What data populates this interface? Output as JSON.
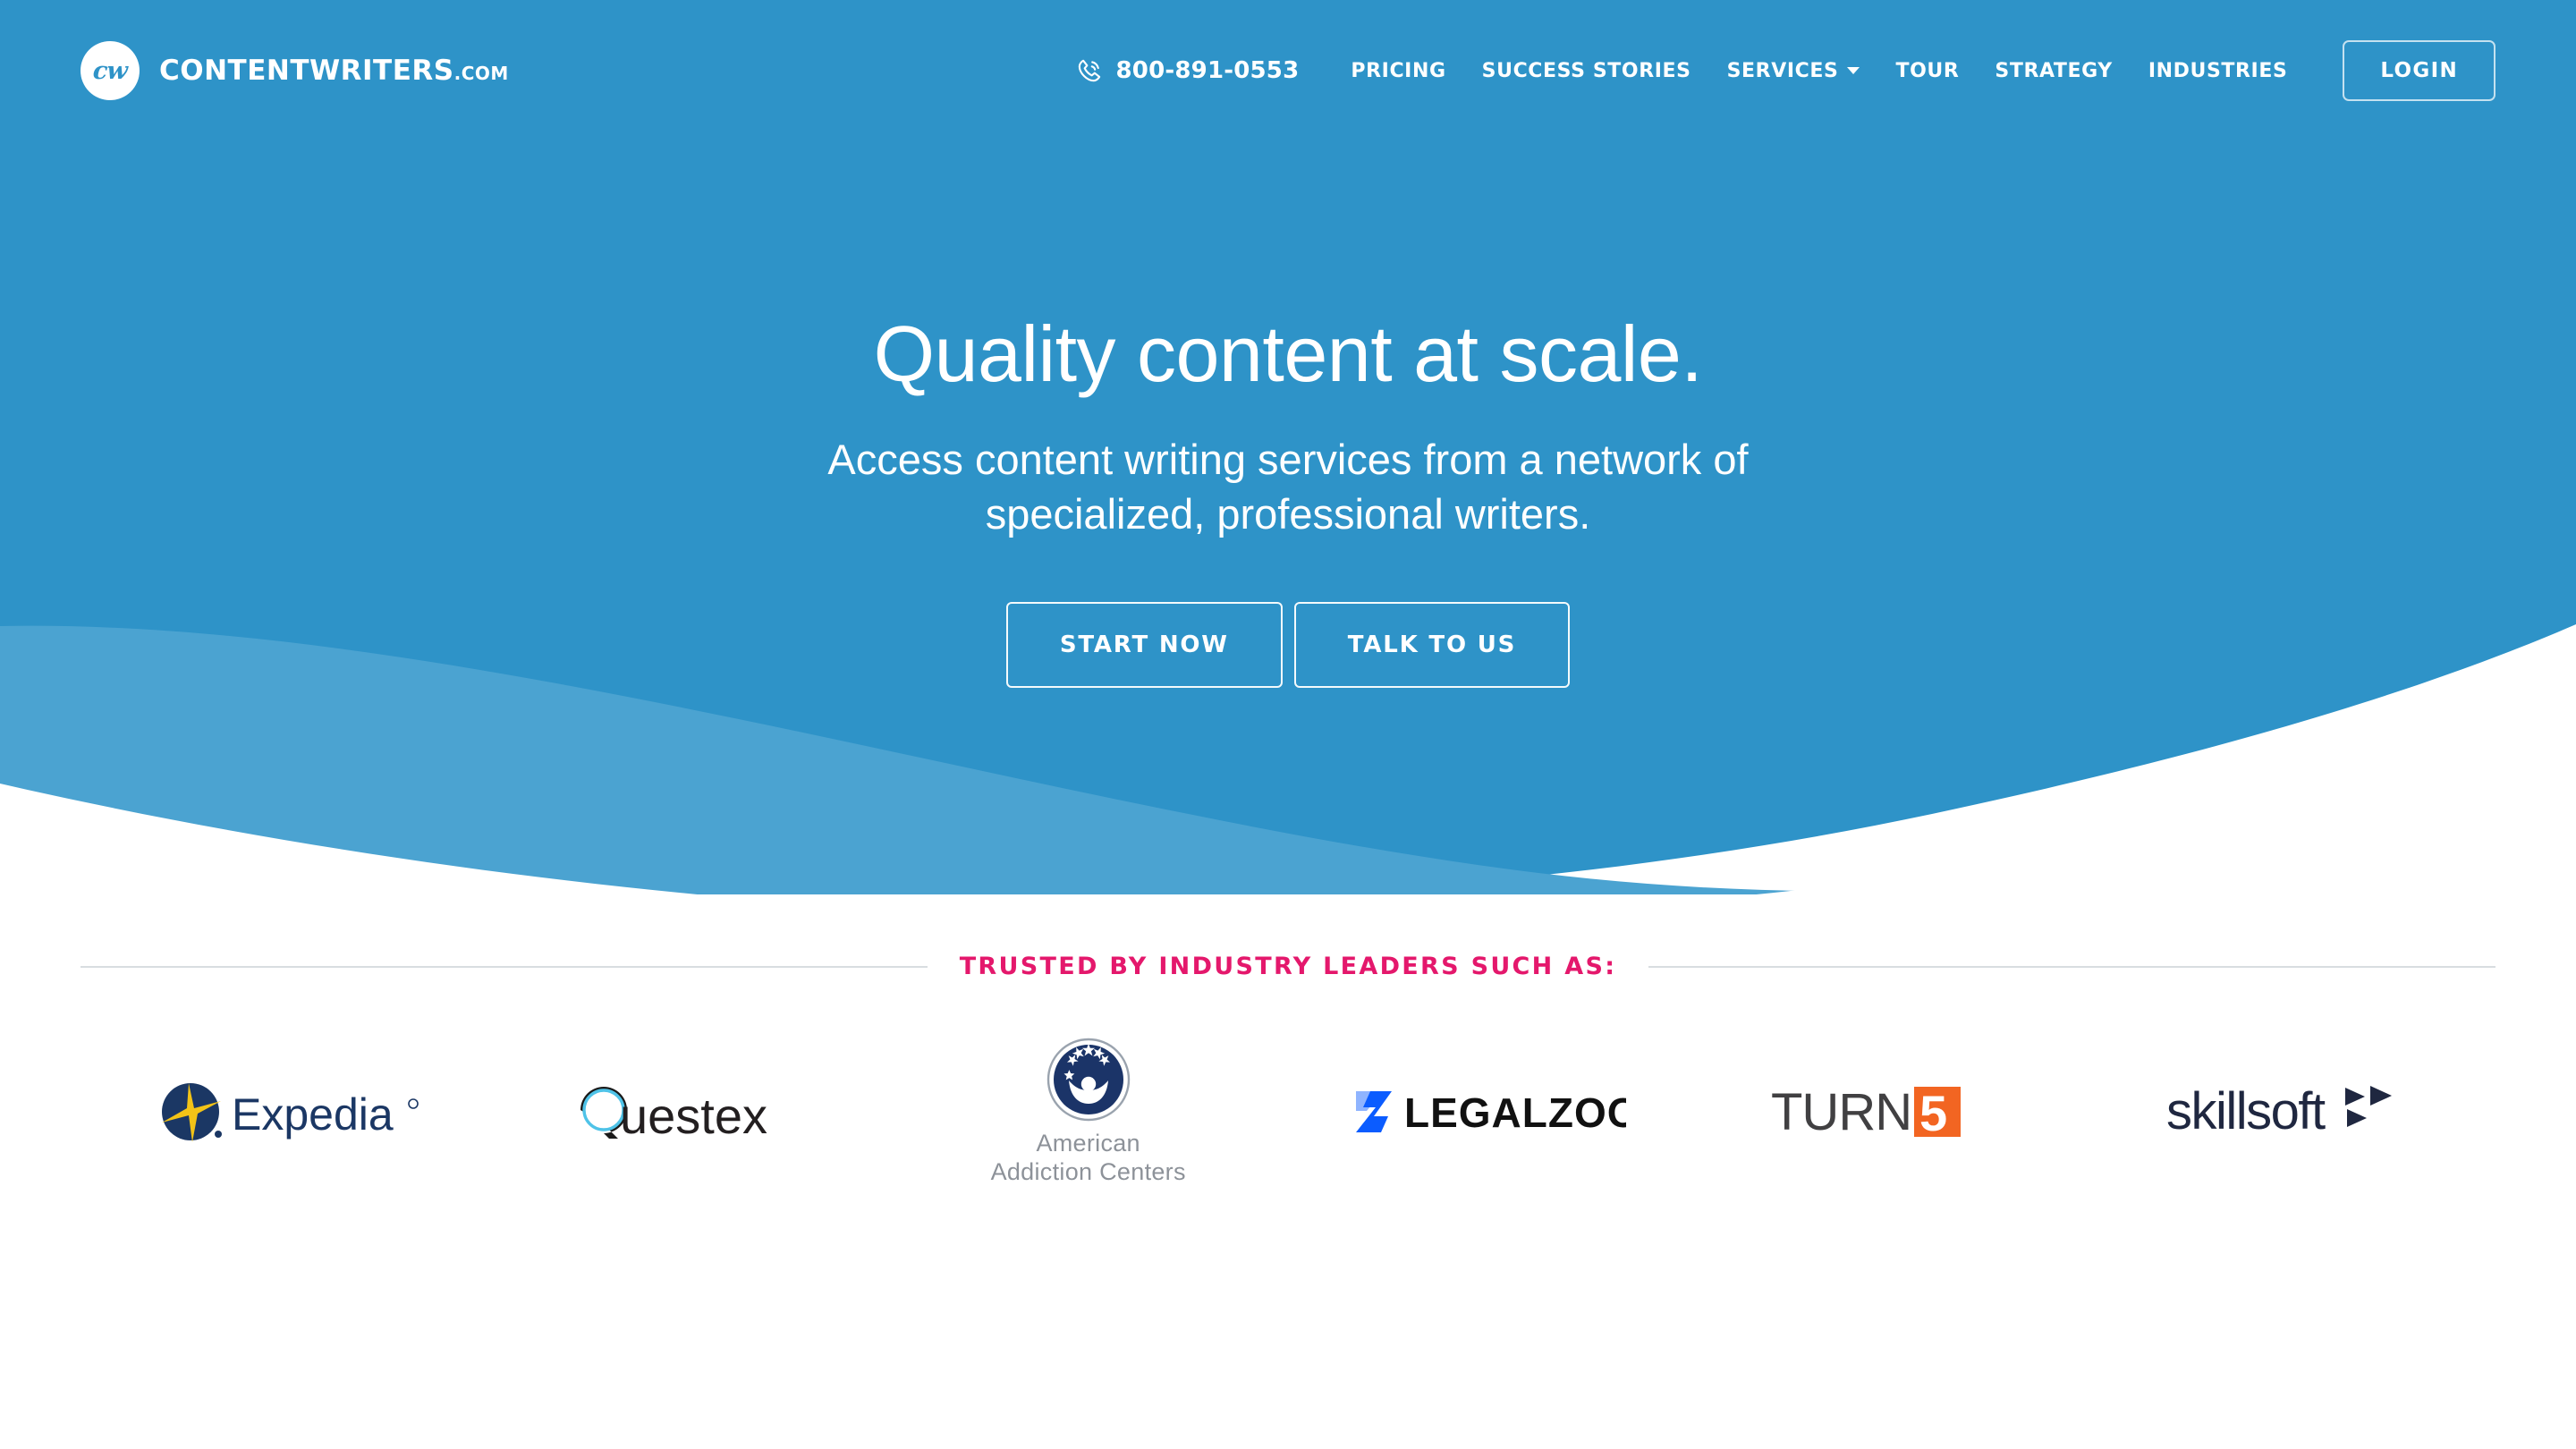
{
  "theme": {
    "hero_blue": "#2e93c8",
    "wave_light_blue": "#4ba3d1",
    "accent_pink": "#e4186c",
    "white": "#ffffff"
  },
  "header": {
    "brand": {
      "badge_text": "cw",
      "name": "CONTENTWRITERS",
      "tld": ".COM",
      "badge_icon": "cw-monogram-icon"
    },
    "phone": {
      "icon": "phone-icon",
      "number": "800-891-0553"
    },
    "nav_items": [
      {
        "label": "PRICING",
        "has_dropdown": false
      },
      {
        "label": "SUCCESS STORIES",
        "has_dropdown": false
      },
      {
        "label": "SERVICES",
        "has_dropdown": true
      },
      {
        "label": "TOUR",
        "has_dropdown": false
      },
      {
        "label": "STRATEGY",
        "has_dropdown": false
      },
      {
        "label": "INDUSTRIES",
        "has_dropdown": false
      }
    ],
    "login_label": "LOGIN"
  },
  "hero": {
    "title": "Quality content at scale.",
    "subtitle_line1": "Access content writing services from a network of",
    "subtitle_line2": "specialized, professional writers.",
    "primary_cta": "START NOW",
    "secondary_cta": "TALK TO US"
  },
  "trusted": {
    "label": "TRUSTED BY INDUSTRY LEADERS SUCH AS:",
    "logos": [
      {
        "name": "Expedia",
        "icon": "expedia-logo"
      },
      {
        "name": "Questex",
        "icon": "questex-logo"
      },
      {
        "name": "American Addiction Centers",
        "line1": "American",
        "line2": "Addiction Centers",
        "icon": "american-addiction-centers-logo"
      },
      {
        "name": "LEGALZOOM",
        "icon": "legalzoom-logo"
      },
      {
        "name": "TURN5",
        "icon": "turn5-logo"
      },
      {
        "name": "skillsoft",
        "icon": "skillsoft-logo"
      }
    ]
  }
}
